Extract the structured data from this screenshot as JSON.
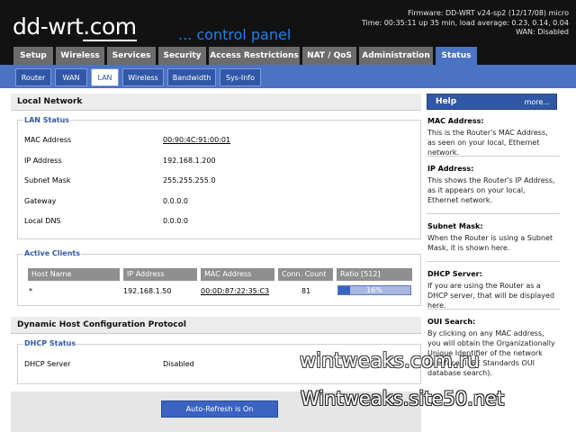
{
  "header": {
    "logo_main": "dd-wrt",
    "logo_suffix": ".com",
    "subtitle": "... control panel",
    "firmware": "Firmware: DD-WRT v24-sp2 (12/17/08) micro",
    "time": "Time: 00:35:11 up 35 min, load average: 0.23, 0.14, 0.04",
    "wan": "WAN: Disabled"
  },
  "top_tabs": [
    "Setup",
    "Wireless",
    "Services",
    "Security",
    "Access Restrictions",
    "NAT / QoS",
    "Administration",
    "Status"
  ],
  "top_tab_active": "Status",
  "sub_tabs": [
    "Router",
    "WAN",
    "LAN",
    "Wireless",
    "Bandwidth",
    "Sys-Info"
  ],
  "sub_tab_active": "LAN",
  "local_network": {
    "title": "Local Network",
    "lan_status": {
      "legend": "LAN Status",
      "fields": [
        {
          "label": "MAC Address",
          "value": "00:90:4C:91:00:01"
        },
        {
          "label": "IP Address",
          "value": "192.168.1.200"
        },
        {
          "label": "Subnet Mask",
          "value": "255.255.255.0"
        },
        {
          "label": "Gateway",
          "value": "0.0.0.0"
        },
        {
          "label": "Local DNS",
          "value": "0.0.0.0"
        }
      ]
    },
    "active_clients": {
      "legend": "Active Clients",
      "headers": [
        "Host Name",
        "IP Address",
        "MAC Address",
        "Conn. Count",
        "Ratio [512]"
      ],
      "rows": [
        {
          "host": "*",
          "ip": "192.168.1.50",
          "mac": "00:0D:87:22:35:C3",
          "conn": "81",
          "ratio": "16%",
          "ratio_fraction": 0.16
        }
      ]
    }
  },
  "dhcp": {
    "title": "Dynamic Host Configuration Protocol",
    "legend": "DHCP Status",
    "server_label": "DHCP Server",
    "server_value": "Disabled"
  },
  "refresh_button": "Auto-Refresh is On",
  "help": {
    "title": "Help",
    "more": "more...",
    "items": [
      {
        "heading": "MAC Address:",
        "text": "This is the Router's MAC Address, as seen on your local, Ethernet network."
      },
      {
        "heading": "IP Address:",
        "text": "This shows the Router's IP Address, as it appears on your local, Ethernet network."
      },
      {
        "heading": "Subnet Mask:",
        "text": "When the Router is using a Subnet Mask, it is shown here."
      },
      {
        "heading": "DHCP Server:",
        "text": "If you are using the Router as a DHCP server, that will be displayed here."
      },
      {
        "heading": "OUI Search:",
        "text": "By clicking on any MAC address, you will obtain the Organizationally Unique Identifier of the network interface (IEEE Standards OUI database search)."
      }
    ]
  },
  "watermarks": {
    "line1": "wintweaks.com.ru",
    "line2": "Wintweaks.site50.net"
  },
  "colors": {
    "header_bg": "#121212",
    "accent_blue": "#4a73c4",
    "dark_blue": "#3158a6",
    "tab_gray": "#6c6c6c"
  }
}
